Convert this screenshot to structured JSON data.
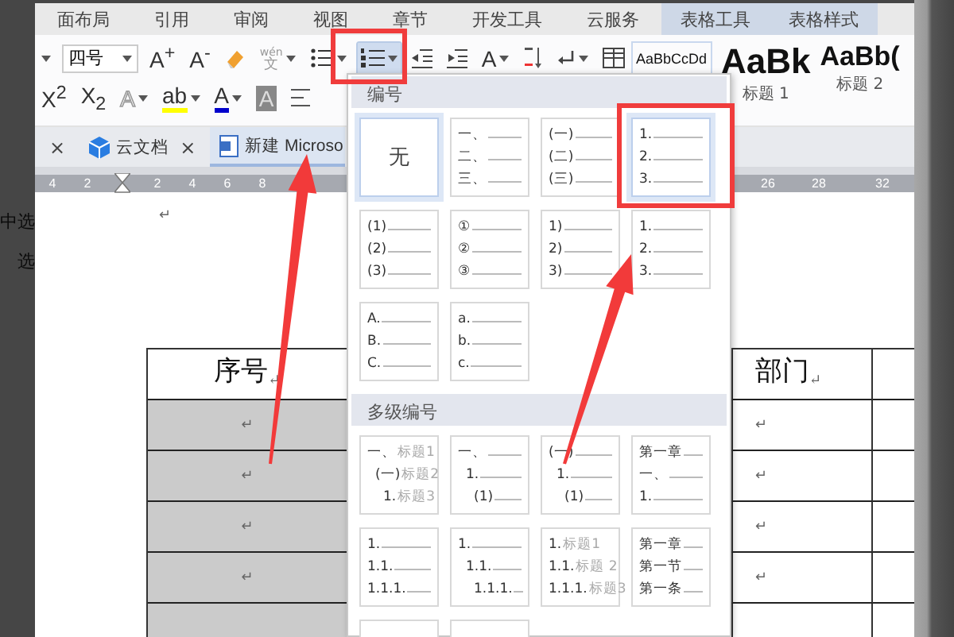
{
  "menu_tabs": [
    {
      "label": "面布局",
      "contextual": false
    },
    {
      "label": "引用",
      "contextual": false
    },
    {
      "label": "审阅",
      "contextual": false
    },
    {
      "label": "视图",
      "contextual": false
    },
    {
      "label": "章节",
      "contextual": false
    },
    {
      "label": "开发工具",
      "contextual": false
    },
    {
      "label": "云服务",
      "contextual": false
    },
    {
      "label": "表格工具",
      "contextual": true
    },
    {
      "label": "表格样式",
      "contextual": true
    }
  ],
  "toolbar": {
    "rows": [
      {
        "items": [
          {
            "kind": "caret",
            "active": false
          },
          {
            "kind": "dropdown",
            "value": "四号",
            "active": false
          },
          {
            "kind": "glyph",
            "text": "A$^{+}$",
            "active": false
          },
          {
            "kind": "glyph",
            "text": "A$^{-}$",
            "active": false
          },
          {
            "kind": "eraser",
            "active": false
          },
          {
            "kind": "pinyin",
            "top": "wén",
            "bottom": "文",
            "active": false
          },
          {
            "kind": "bullets",
            "caret": true,
            "active": false
          },
          {
            "kind": "numbering",
            "caret": true,
            "active": true
          },
          {
            "kind": "indent-decrease",
            "active": false
          },
          {
            "kind": "indent-increase",
            "active": false
          },
          {
            "kind": "glyph",
            "text": "A",
            "caret": true,
            "active": false
          },
          {
            "kind": "sort",
            "active": false
          },
          {
            "kind": "return",
            "caret": true,
            "active": false
          },
          {
            "kind": "table",
            "active": false
          }
        ]
      },
      {
        "items": [
          {
            "kind": "glyph",
            "text": "X$^{2}$",
            "active": false
          },
          {
            "kind": "glyph",
            "text": "X$_{2}$",
            "active": false
          },
          {
            "kind": "outline-glyph",
            "text": "A",
            "caret": true,
            "active": false
          },
          {
            "kind": "glyph",
            "text": "ab",
            "caret": true,
            "active": false,
            "color": "#ffff00"
          },
          {
            "kind": "glyph",
            "text": "A",
            "caret": true,
            "active": false,
            "color": "#0000cc"
          },
          {
            "kind": "shaded-glyph",
            "text": "A",
            "active": false
          },
          {
            "kind": "align-left",
            "active": false
          }
        ]
      }
    ],
    "styles": [
      {
        "kind": "body",
        "preview": "AaBbCcDd"
      },
      {
        "kind": "heading1",
        "preview": "AaBk",
        "label": "标题 1"
      },
      {
        "kind": "heading2",
        "preview": "AaBb(",
        "label": "标题 2"
      }
    ]
  },
  "doc_tabs": [
    {
      "kind": "close-only",
      "close": "×",
      "selected": false
    },
    {
      "kind": "cloud-tab",
      "label": "云文档",
      "close": "×",
      "selected": false
    },
    {
      "kind": "doc-tab",
      "label": "新建 Microso",
      "selected": true
    }
  ],
  "ruler": {
    "left_labels": [
      "4",
      "2",
      "2",
      "4",
      "6",
      "8"
    ],
    "right_labels": [
      "26",
      "28",
      "32"
    ]
  },
  "side_text": [
    "中选",
    "选"
  ],
  "document": {
    "paragraph_mark": "↵",
    "table": {
      "header": [
        {
          "text": "序号",
          "mark": "↵",
          "selected": false
        },
        {
          "text": "部门",
          "mark": "↵",
          "selected": false
        }
      ],
      "rows": [
        {
          "cells": [
            {
              "text": "↵",
              "selected": true
            },
            {
              "text": "↵",
              "selected": false
            }
          ]
        },
        {
          "cells": [
            {
              "text": "↵",
              "selected": true
            },
            {
              "text": "↵",
              "selected": false
            }
          ]
        },
        {
          "cells": [
            {
              "text": "↵",
              "selected": true
            },
            {
              "text": "↵",
              "selected": false
            }
          ]
        },
        {
          "cells": [
            {
              "text": "↵",
              "selected": true
            },
            {
              "text": "↵",
              "selected": false
            }
          ]
        }
      ]
    }
  },
  "numbering": {
    "sections": [
      {
        "title": "编号",
        "items": [
          {
            "kind": "none",
            "label": "无",
            "selected": true
          },
          {
            "kind": "list",
            "selected": false,
            "indented": false,
            "lines": [
              {
                "label": "一、"
              },
              {
                "label": "二、"
              },
              {
                "label": "三、"
              }
            ]
          },
          {
            "kind": "list",
            "selected": false,
            "indented": false,
            "lines": [
              {
                "label": "(一)"
              },
              {
                "label": "(二)"
              },
              {
                "label": "(三)"
              }
            ]
          },
          {
            "kind": "list",
            "selected": true,
            "indented": false,
            "lines": [
              {
                "label": "1."
              },
              {
                "label": "2."
              },
              {
                "label": "3."
              }
            ]
          },
          {
            "kind": "list",
            "selected": false,
            "indented": false,
            "lines": [
              {
                "label": "(1)"
              },
              {
                "label": "(2)"
              },
              {
                "label": "(3)"
              }
            ]
          },
          {
            "kind": "list",
            "selected": false,
            "indented": false,
            "lines": [
              {
                "label": "①"
              },
              {
                "label": "②"
              },
              {
                "label": "③"
              }
            ]
          },
          {
            "kind": "list",
            "selected": false,
            "indented": false,
            "lines": [
              {
                "label": "1)"
              },
              {
                "label": "2)"
              },
              {
                "label": "3)"
              }
            ]
          },
          {
            "kind": "list",
            "selected": false,
            "indented": false,
            "lines": [
              {
                "label": "1."
              },
              {
                "label": "2."
              },
              {
                "label": "3."
              }
            ]
          },
          {
            "kind": "list",
            "selected": false,
            "indented": false,
            "lines": [
              {
                "label": "A."
              },
              {
                "label": "B."
              },
              {
                "label": "C."
              }
            ]
          },
          {
            "kind": "list",
            "selected": false,
            "indented": false,
            "lines": [
              {
                "label": "a."
              },
              {
                "label": "b."
              },
              {
                "label": "c."
              }
            ]
          }
        ]
      },
      {
        "title": "多级编号",
        "items": [
          {
            "kind": "list",
            "selected": false,
            "indented": true,
            "lines": [
              {
                "label": "一、",
                "heading": "标题1"
              },
              {
                "label": "(一)",
                "heading": "标题2"
              },
              {
                "label": "1.",
                "heading": "标题3"
              }
            ]
          },
          {
            "kind": "list",
            "selected": false,
            "indented": true,
            "lines": [
              {
                "label": "一、"
              },
              {
                "label": "1."
              },
              {
                "label": "(1)"
              }
            ]
          },
          {
            "kind": "list",
            "selected": false,
            "indented": true,
            "lines": [
              {
                "label": "(一)"
              },
              {
                "label": "1."
              },
              {
                "label": "(1)"
              }
            ]
          },
          {
            "kind": "list",
            "selected": false,
            "indented": false,
            "lines": [
              {
                "label": "第一章"
              },
              {
                "label": "一、"
              },
              {
                "label": "1."
              }
            ]
          },
          {
            "kind": "list",
            "selected": false,
            "indented": false,
            "lines": [
              {
                "label": "1."
              },
              {
                "label": "1.1."
              },
              {
                "label": "1.1.1."
              }
            ]
          },
          {
            "kind": "list",
            "selected": false,
            "indented": true,
            "lines": [
              {
                "label": "1."
              },
              {
                "label": "1.1."
              },
              {
                "label": "1.1.1."
              }
            ]
          },
          {
            "kind": "list",
            "selected": false,
            "indented": false,
            "lines": [
              {
                "label": "1.",
                "heading": "标题1"
              },
              {
                "label": "1.1.",
                "heading": "标题 2"
              },
              {
                "label": "1.1.1.",
                "heading": "标题3"
              }
            ]
          },
          {
            "kind": "list",
            "selected": false,
            "indented": false,
            "lines": [
              {
                "label": "第一章"
              },
              {
                "label": "第一节"
              },
              {
                "label": "第一条"
              }
            ]
          },
          {
            "kind": "blank",
            "selected": false
          },
          {
            "kind": "blank",
            "selected": false
          }
        ]
      }
    ]
  }
}
